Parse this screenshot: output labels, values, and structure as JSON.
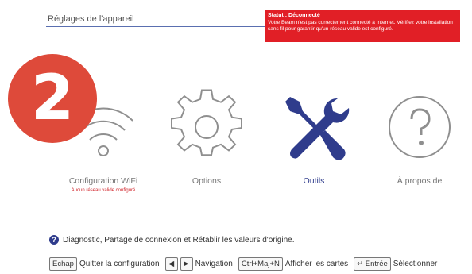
{
  "header": {
    "title": "Réglages de l'appareil"
  },
  "status": {
    "title": "Statut : Déconnecté",
    "message": "Votre Beam n'est pas correctement connecté à Internet. Vérifiez votre installation sans fil pour garantir qu'un réseau valide est configuré."
  },
  "step": "2",
  "tiles": [
    {
      "label": "Configuration WiFi",
      "sublabel": "Aucun réseau valide configuré",
      "icon": "wifi-icon"
    },
    {
      "label": "Options",
      "icon": "gear-icon"
    },
    {
      "label": "Outils",
      "icon": "tools-icon",
      "selected": true
    },
    {
      "label": "À propos de",
      "icon": "question-icon"
    }
  ],
  "hint": {
    "text": "Diagnostic, Partage de connexion et Rétablir les valeurs d'origine."
  },
  "shortcuts": {
    "esc_key": "Échap",
    "esc_label": "Quitter la configuration",
    "left_key": "◀",
    "right_key": "►",
    "nav_label": "Navigation",
    "cards_key": "Ctrl+Maj+N",
    "cards_label": "Afficher les cartes",
    "enter_key": "↵ Entrée",
    "enter_label": "Sélectionner"
  },
  "colors": {
    "accent": "#2f3c8c",
    "status_bg": "#e11f26",
    "badge": "#de4a3a"
  }
}
